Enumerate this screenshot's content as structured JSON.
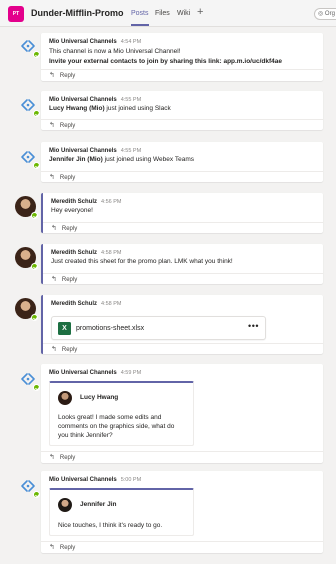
{
  "header": {
    "team_initials": "PT",
    "team_name": "Dunder-Mifflin-Promo",
    "tabs": [
      {
        "label": "Posts",
        "active": true
      },
      {
        "label": "Files",
        "active": false
      },
      {
        "label": "Wiki",
        "active": false
      }
    ],
    "add_tab_icon": "+",
    "org_label": "Org"
  },
  "accent": "#6264a7",
  "reply_label": "Reply",
  "messages": [
    {
      "author": "Mio Universal Channels",
      "time": "4:54 PM",
      "avatar": "mio-bot-icon",
      "lines": [
        "This channel is now a Mio Universal Channel!",
        "Invite your external contacts to join by sharing this link: app.m.io/uc/dkf4ae"
      ]
    },
    {
      "author": "Mio Universal Channels",
      "time": "4:55 PM",
      "avatar": "mio-bot-icon",
      "name_bold": "Lucy Hwang (Mio)",
      "text": " just joined using Slack"
    },
    {
      "author": "Mio Universal Channels",
      "time": "4:55 PM",
      "avatar": "mio-bot-icon",
      "name_bold": "Jennifer Jin (Mio)",
      "text": " just joined using Webex Teams"
    },
    {
      "author": "Meredith Schulz",
      "time": "4:56 PM",
      "avatar": "user-avatar",
      "text": "Hey everyone!"
    },
    {
      "author": "Meredith Schulz",
      "time": "4:58 PM",
      "avatar": "user-avatar",
      "text": "Just created this sheet for the promo plan. LMK what you think!"
    },
    {
      "author": "Meredith Schulz",
      "time": "4:58 PM",
      "avatar": "user-avatar",
      "file": {
        "icon": "excel-icon",
        "name": "promotions-sheet.xlsx",
        "more": "•••"
      }
    },
    {
      "author": "Mio Universal Channels",
      "time": "4:59 PM",
      "avatar": "mio-bot-icon",
      "quote": {
        "name": "Lucy Hwang",
        "lines": [
          "Looks great! I made some edits and",
          "comments on the graphics side, what do",
          "you think Jennifer?"
        ]
      }
    },
    {
      "author": "Mio Universal Channels",
      "time": "5:00 PM",
      "avatar": "mio-bot-icon",
      "quote": {
        "name": "Jennifer Jin",
        "lines": [
          "Nice touches, I think it's ready to go."
        ]
      }
    }
  ]
}
